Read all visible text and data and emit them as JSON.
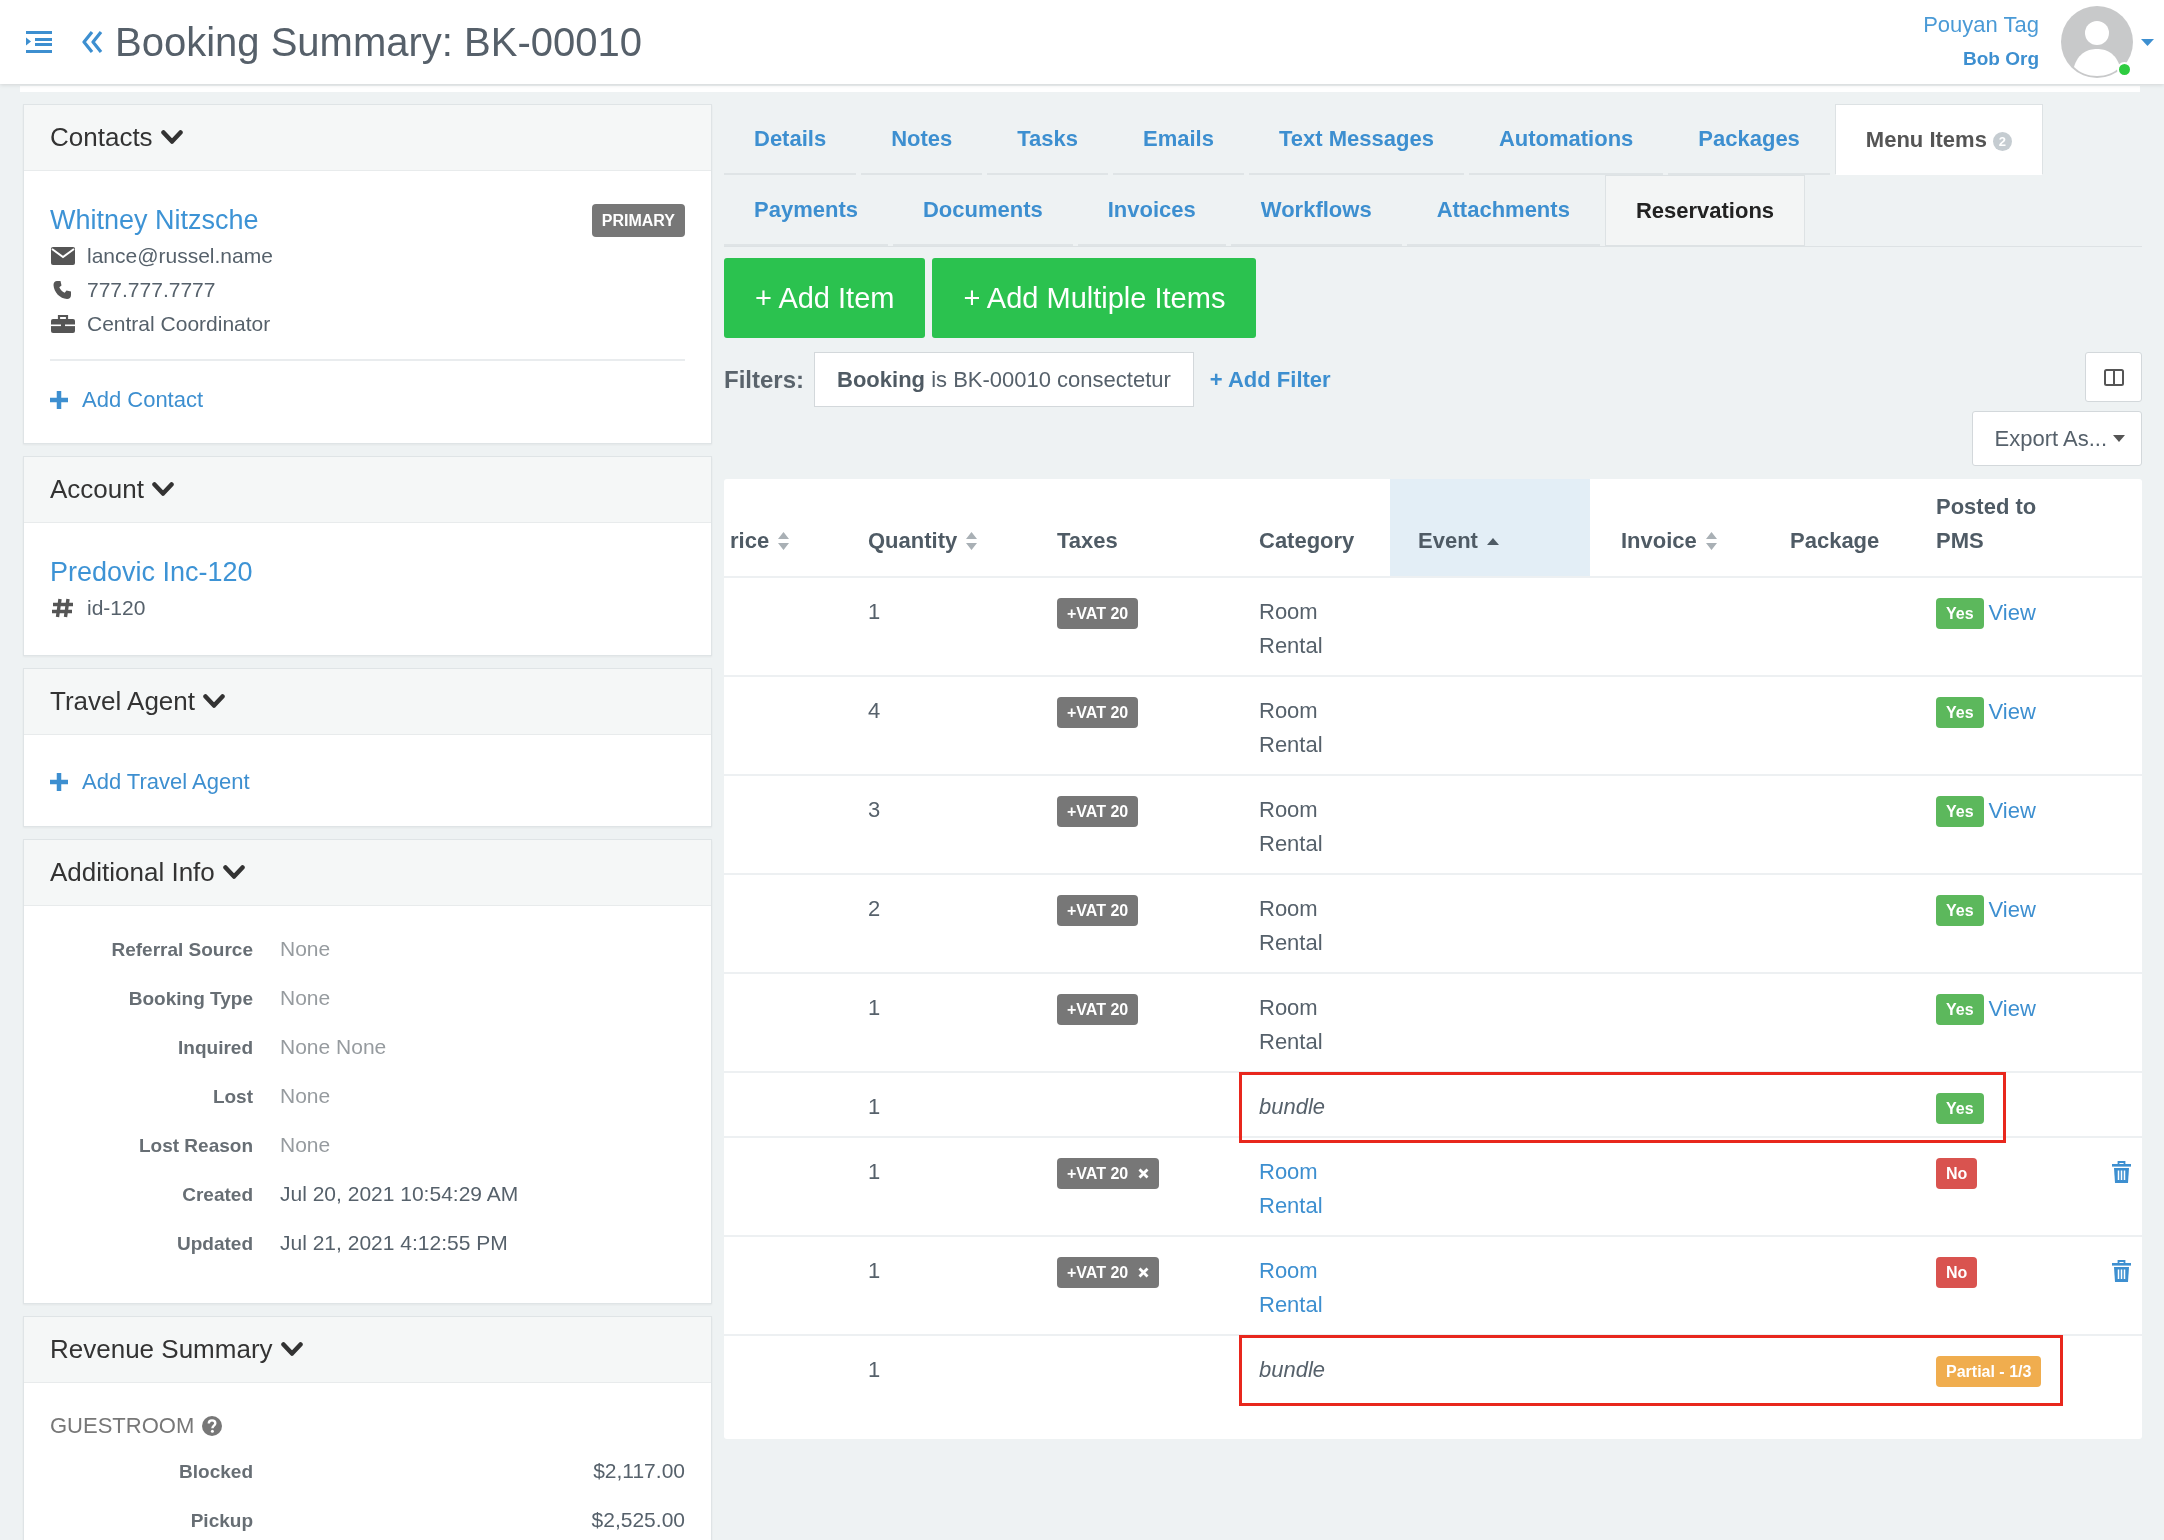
{
  "header": {
    "title": "Booking Summary: BK-00010",
    "user": {
      "name": "Pouyan Tag",
      "org": "Bob Org",
      "online": true
    }
  },
  "contacts_panel": {
    "title": "Contacts",
    "expanded": true,
    "contacts": [
      {
        "name": "Whitney Nitzsche",
        "badge": "PRIMARY",
        "email": "lance@russel.name",
        "phone": "777.777.7777",
        "role": "Central Coordinator"
      }
    ],
    "add_link": "Add Contact"
  },
  "account_panel": {
    "title": "Account",
    "expanded": true,
    "name": "Predovic Inc-120",
    "id": "id-120"
  },
  "travel_agent_panel": {
    "title": "Travel Agent",
    "expanded": true,
    "add_link": "Add Travel Agent"
  },
  "additional_info_panel": {
    "title": "Additional Info",
    "expanded": true,
    "fields": [
      {
        "label": "Referral Source",
        "value": "None",
        "empty": true
      },
      {
        "label": "Booking Type",
        "value": "None",
        "empty": true
      },
      {
        "label": "Inquired",
        "value": "None None",
        "empty": true
      },
      {
        "label": "Lost",
        "value": "None",
        "empty": true
      },
      {
        "label": "Lost Reason",
        "value": "None",
        "empty": true
      },
      {
        "label": "Created",
        "value": "Jul 20, 2021 10:54:29 AM",
        "empty": false
      },
      {
        "label": "Updated",
        "value": "Jul 21, 2021 4:12:55 PM",
        "empty": false
      }
    ]
  },
  "revenue_summary_panel": {
    "title": "Revenue Summary",
    "expanded": true,
    "section": "GUESTROOM",
    "rows": [
      {
        "label": "Blocked",
        "value": "$2,117.00"
      },
      {
        "label": "Pickup",
        "value": "$2,525.00"
      }
    ]
  },
  "tab_rows": [
    {
      "tabs": [
        {
          "label": "Details",
          "selected": false,
          "hovered": false
        },
        {
          "label": "Notes",
          "selected": false,
          "hovered": false
        },
        {
          "label": "Tasks",
          "selected": false,
          "hovered": false
        },
        {
          "label": "Emails",
          "selected": false,
          "hovered": false
        },
        {
          "label": "Text Messages",
          "selected": false,
          "hovered": false
        },
        {
          "label": "Automations",
          "selected": false,
          "hovered": false
        },
        {
          "label": "Packages",
          "selected": false,
          "hovered": false
        },
        {
          "label": "Menu Items",
          "count": "2",
          "selected": true,
          "hovered": false
        }
      ]
    },
    {
      "tabs": [
        {
          "label": "Payments",
          "selected": false,
          "hovered": false
        },
        {
          "label": "Documents",
          "selected": false,
          "hovered": false
        },
        {
          "label": "Invoices",
          "selected": false,
          "hovered": false
        },
        {
          "label": "Workflows",
          "selected": false,
          "hovered": false
        },
        {
          "label": "Attachments",
          "selected": false,
          "hovered": false
        },
        {
          "label": "Reservations",
          "selected": false,
          "hovered": true
        }
      ]
    }
  ],
  "actions": [
    "+ Add Item",
    "+ Add Multiple Items"
  ],
  "filters": {
    "label": "Filters:",
    "chips": [
      "**Booking** is BK-00010 consectetur"
    ],
    "add_link": "+ Add Filter"
  },
  "export_button": "Export As...",
  "table": {
    "columns": [
      {
        "label": "rice",
        "sortable": true,
        "sorted": false
      },
      {
        "label": "Quantity",
        "sortable": true,
        "sorted": false
      },
      {
        "label": "Taxes",
        "sortable": false,
        "sorted": false
      },
      {
        "label": "Category",
        "sortable": false,
        "sorted": false
      },
      {
        "label": "Event",
        "sortable": true,
        "sorted": true
      },
      {
        "label": "Invoice",
        "sortable": true,
        "sorted": false
      },
      {
        "label": "Package",
        "sortable": false,
        "sorted": false
      },
      {
        "label": "Posted to PMS",
        "sortable": false,
        "sorted": false
      }
    ],
    "rows": [
      {
        "quantity": "1",
        "tax": {
          "label": "+VAT 20",
          "removable": false
        },
        "category": {
          "text": "Room Rental",
          "kind": "plain"
        },
        "posted": {
          "text": "Yes",
          "color": "#5cb85c"
        },
        "view": "View",
        "deletable": false,
        "highlighted": false
      },
      {
        "quantity": "4",
        "tax": {
          "label": "+VAT 20",
          "removable": false
        },
        "category": {
          "text": "Room Rental",
          "kind": "plain"
        },
        "posted": {
          "text": "Yes",
          "color": "#5cb85c"
        },
        "view": "View",
        "deletable": false,
        "highlighted": false
      },
      {
        "quantity": "3",
        "tax": {
          "label": "+VAT 20",
          "removable": false
        },
        "category": {
          "text": "Room Rental",
          "kind": "plain"
        },
        "posted": {
          "text": "Yes",
          "color": "#5cb85c"
        },
        "view": "View",
        "deletable": false,
        "highlighted": false
      },
      {
        "quantity": "2",
        "tax": {
          "label": "+VAT 20",
          "removable": false
        },
        "category": {
          "text": "Room Rental",
          "kind": "plain"
        },
        "posted": {
          "text": "Yes",
          "color": "#5cb85c"
        },
        "view": "View",
        "deletable": false,
        "highlighted": false
      },
      {
        "quantity": "1",
        "tax": {
          "label": "+VAT 20",
          "removable": false
        },
        "category": {
          "text": "Room Rental",
          "kind": "plain"
        },
        "posted": {
          "text": "Yes",
          "color": "#5cb85c"
        },
        "view": "View",
        "deletable": false,
        "highlighted": false
      },
      {
        "quantity": "1",
        "category": {
          "text": "bundle",
          "kind": "italic"
        },
        "posted": {
          "text": "Yes",
          "color": "#5cb85c"
        },
        "deletable": false,
        "highlighted": true
      },
      {
        "quantity": "1",
        "tax": {
          "label": "+VAT 20",
          "removable": true
        },
        "category": {
          "text": "Room Rental",
          "kind": "link"
        },
        "posted": {
          "text": "No",
          "color": "#d9534f"
        },
        "deletable": true,
        "highlighted": false
      },
      {
        "quantity": "1",
        "tax": {
          "label": "+VAT 20",
          "removable": true
        },
        "category": {
          "text": "Room Rental",
          "kind": "link"
        },
        "posted": {
          "text": "No",
          "color": "#d9534f"
        },
        "deletable": true,
        "highlighted": false
      },
      {
        "quantity": "1",
        "category": {
          "text": "bundle",
          "kind": "italic"
        },
        "posted": {
          "text": "Partial - 1/3",
          "color": "#f0ad4e"
        },
        "deletable": false,
        "highlighted": true
      }
    ]
  }
}
